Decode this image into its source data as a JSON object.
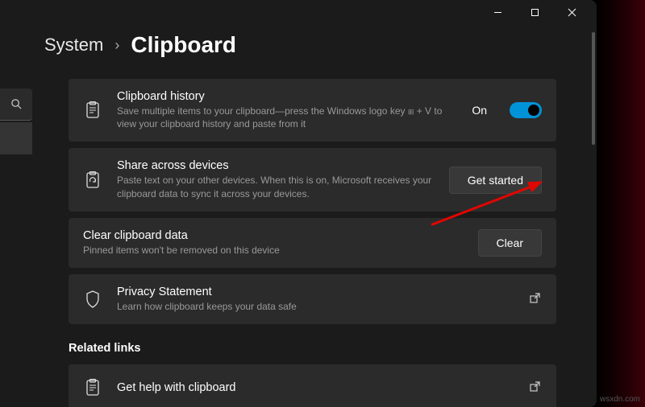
{
  "breadcrumb": {
    "parent": "System",
    "current": "Clipboard"
  },
  "cards": {
    "history": {
      "title": "Clipboard history",
      "desc_a": "Save multiple items to your clipboard—press the Windows logo key ",
      "desc_b": " + V to view your clipboard history and paste from it",
      "toggle_label": "On",
      "toggle_on": true
    },
    "share": {
      "title": "Share across devices",
      "desc": "Paste text on your other devices. When this is on, Microsoft receives your clipboard data to sync it across your devices.",
      "button": "Get started"
    },
    "clear": {
      "title": "Clear clipboard data",
      "desc": "Pinned items won't be removed on this device",
      "button": "Clear"
    },
    "privacy": {
      "title": "Privacy Statement",
      "desc": "Learn how clipboard keeps your data safe"
    },
    "help": {
      "title": "Get help with clipboard"
    }
  },
  "related_heading": "Related links",
  "watermark": "wsxdn.com"
}
